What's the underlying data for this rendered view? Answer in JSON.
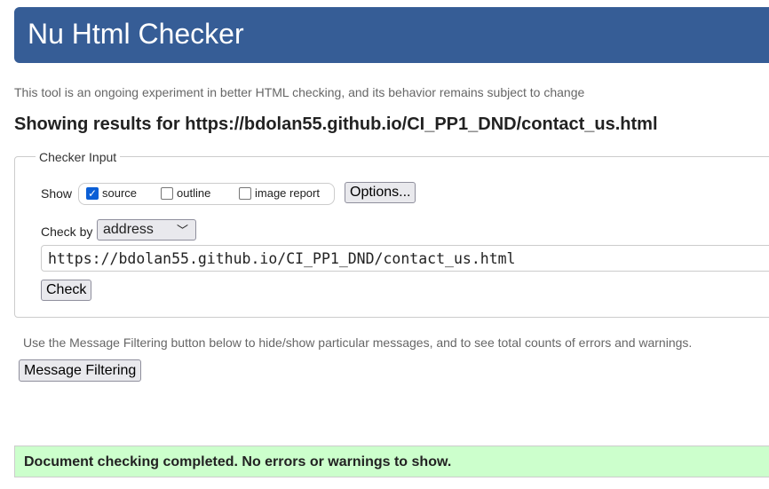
{
  "header": {
    "title": "Nu Html Checker"
  },
  "tagline": "This tool is an ongoing experiment in better HTML checking, and its behavior remains subject to change",
  "results_heading": "Showing results for https://bdolan55.github.io/CI_PP1_DND/contact_us.html",
  "checker_input": {
    "legend": "Checker Input",
    "show_label": "Show",
    "show_options": [
      {
        "label": "source",
        "checked": true
      },
      {
        "label": "outline",
        "checked": false
      },
      {
        "label": "image report",
        "checked": false
      }
    ],
    "options_button": "Options...",
    "check_by_label": "Check by",
    "check_by_value": "address",
    "url_value": "https://bdolan55.github.io/CI_PP1_DND/contact_us.html",
    "check_button": "Check"
  },
  "filter_note": "Use the Message Filtering button below to hide/show particular messages, and to see total counts of errors and warnings.",
  "filter_button": "Message Filtering",
  "status": "Document checking completed. No errors or warnings to show.",
  "colors": {
    "header": "#365d96",
    "success": "#ccffcc",
    "checkbox": "#0b5fd6"
  }
}
